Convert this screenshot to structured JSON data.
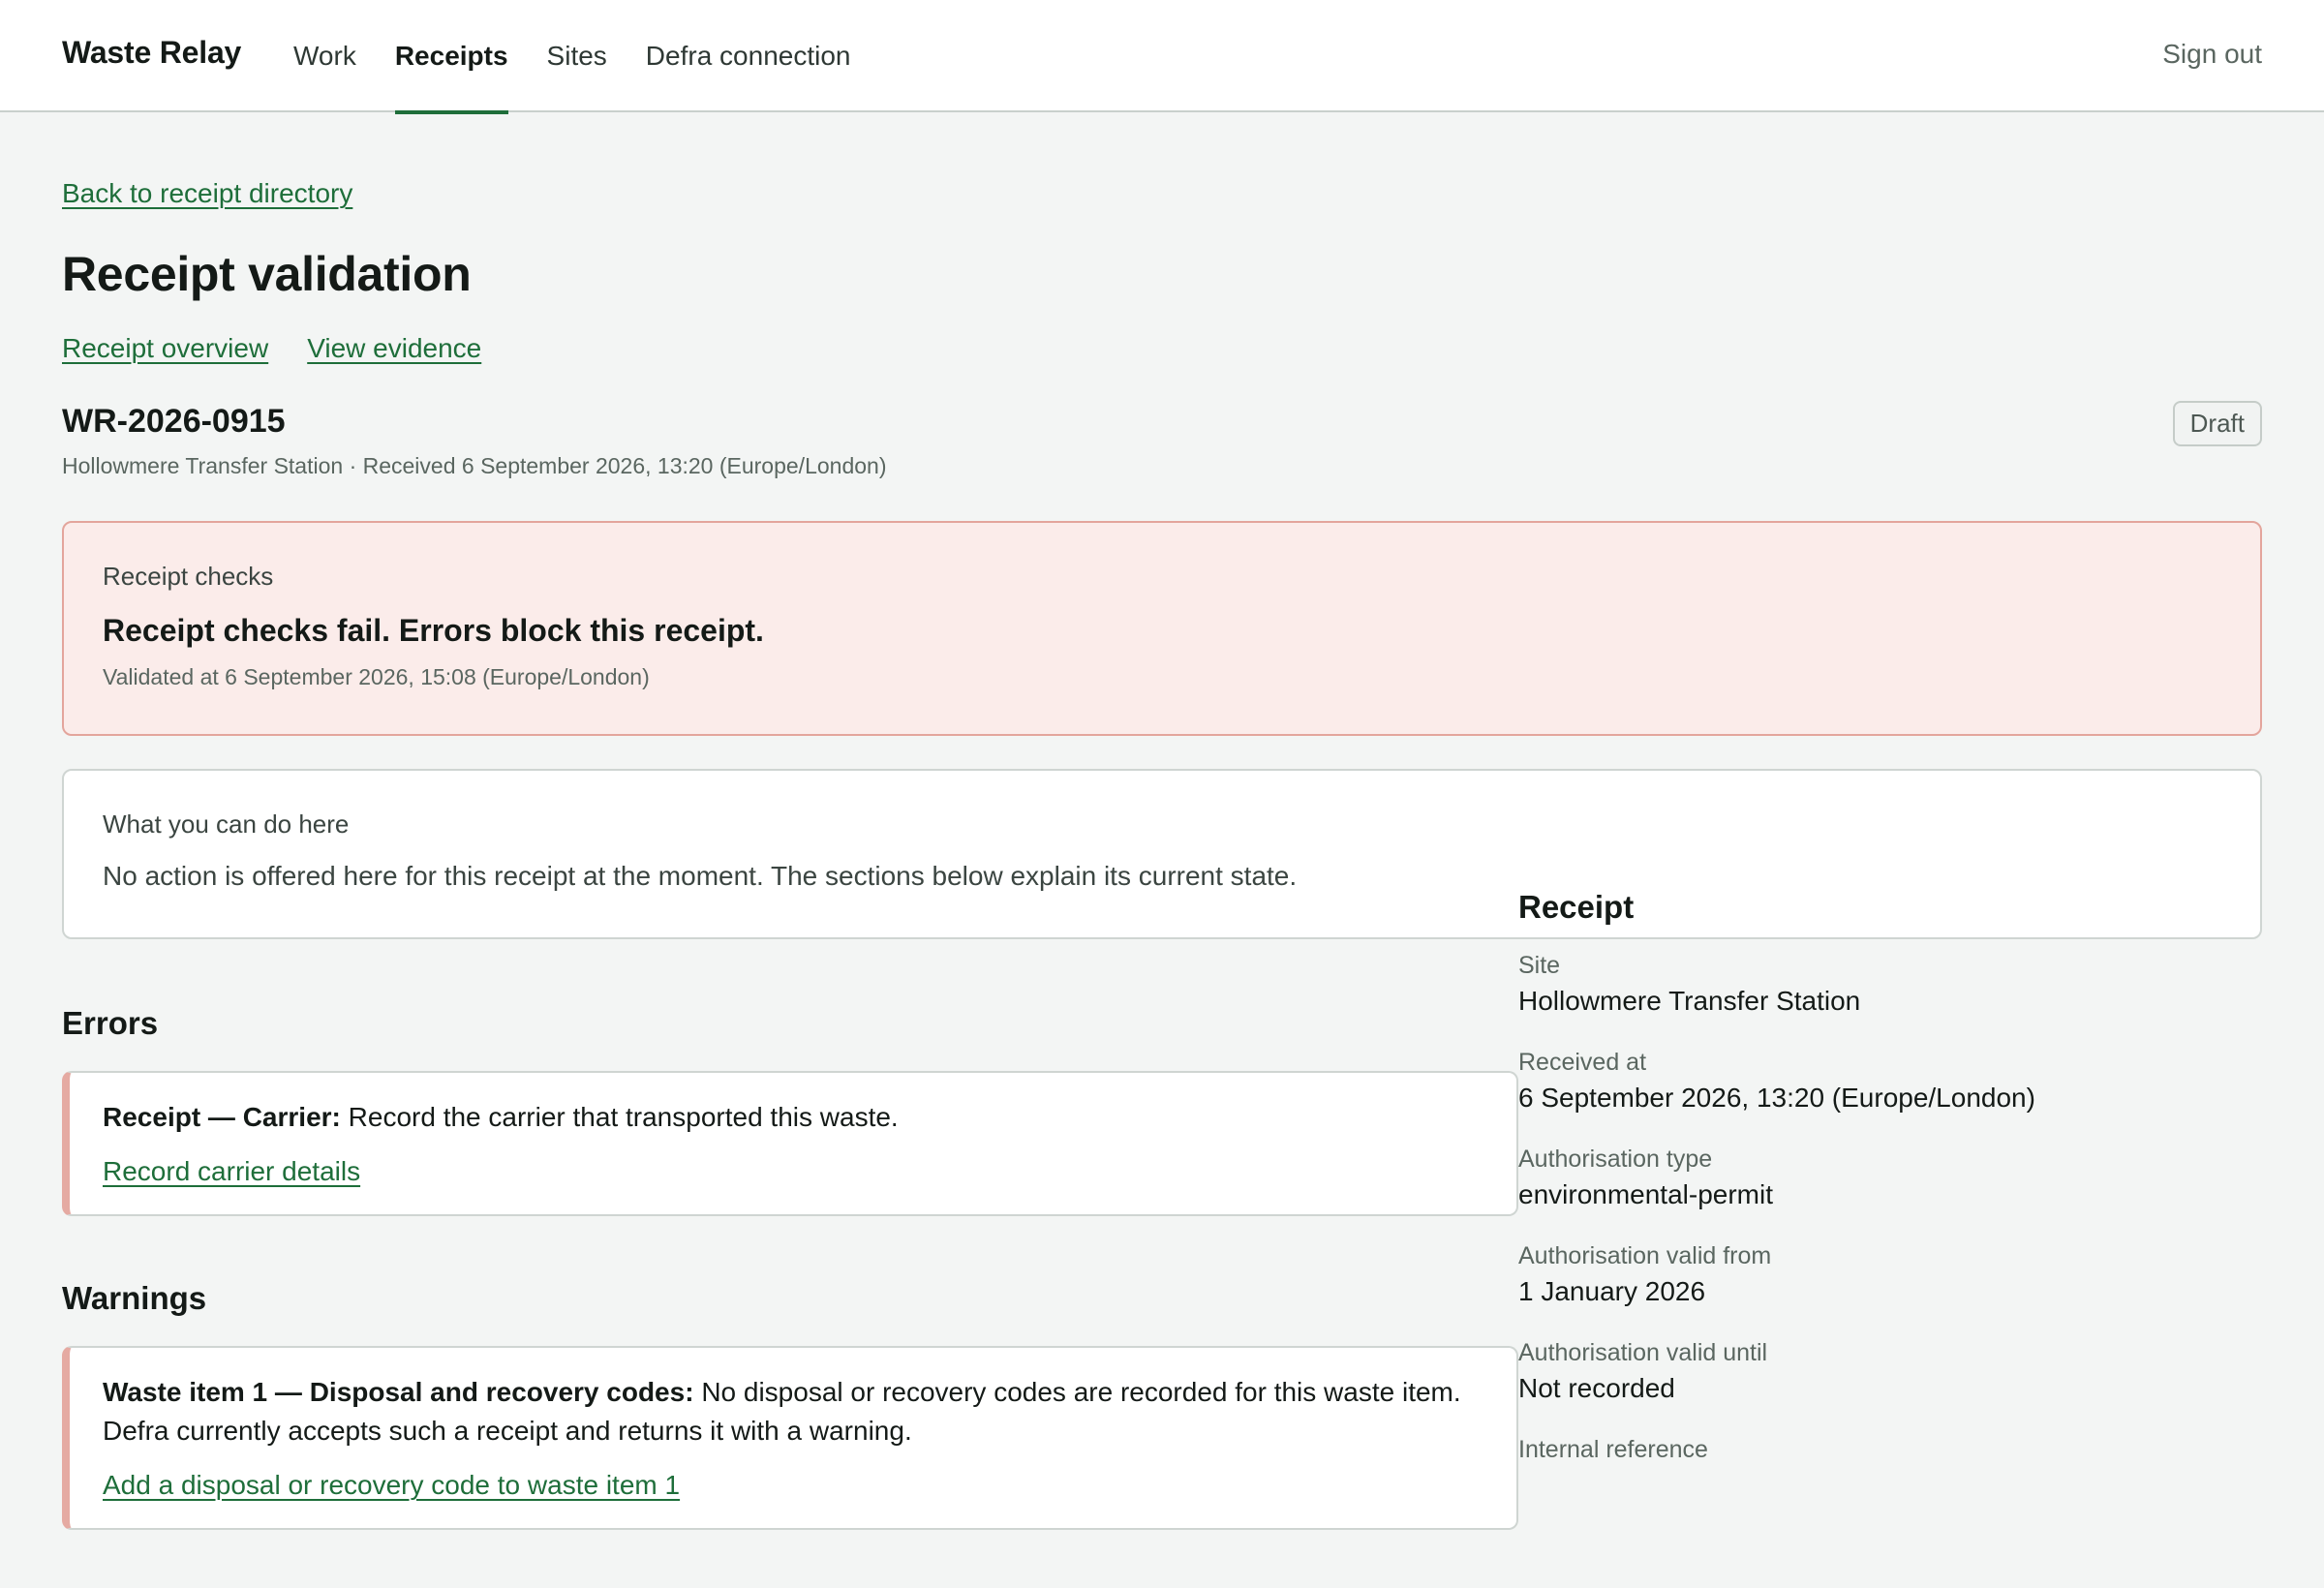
{
  "header": {
    "brand": "Waste Relay",
    "nav": [
      {
        "label": "Work",
        "active": false
      },
      {
        "label": "Receipts",
        "active": true
      },
      {
        "label": "Sites",
        "active": false
      },
      {
        "label": "Defra connection",
        "active": false
      }
    ],
    "sign_out": "Sign out"
  },
  "page": {
    "back_link": "Back to receipt directory",
    "title": "Receipt validation",
    "sub_links": [
      "Receipt overview",
      "View evidence"
    ],
    "receipt_ref": "WR-2026-0915",
    "receipt_meta": "Hollowmere Transfer Station · Received 6 September 2026, 13:20 (Europe/London)",
    "status": "Draft"
  },
  "checks": {
    "kicker": "Receipt checks",
    "headline": "Receipt checks fail. Errors block this receipt.",
    "validated_at": "Validated at 6 September 2026, 15:08 (Europe/London)"
  },
  "actions": {
    "kicker": "What you can do here",
    "body": "No action is offered here for this receipt at the moment. The sections below explain its current state."
  },
  "errors": {
    "heading": "Errors",
    "items": [
      {
        "subject": "Receipt — Carrier:",
        "message": "Record the carrier that transported this waste.",
        "link": "Record carrier details"
      }
    ]
  },
  "warnings": {
    "heading": "Warnings",
    "items": [
      {
        "subject": "Waste item 1 — Disposal and recovery codes:",
        "message": "No disposal or recovery codes are recorded for this waste item. Defra currently accepts such a receipt and returns it with a warning.",
        "link": "Add a disposal or recovery code to waste item 1"
      }
    ]
  },
  "sidebar": {
    "title": "Receipt",
    "rows": [
      {
        "label": "Site",
        "value": "Hollowmere Transfer Station"
      },
      {
        "label": "Received at",
        "value": "6 September 2026, 13:20 (Europe/London)"
      },
      {
        "label": "Authorisation type",
        "value": "environmental-permit"
      },
      {
        "label": "Authorisation valid from",
        "value": "1 January 2026"
      },
      {
        "label": "Authorisation valid until",
        "value": "Not recorded"
      },
      {
        "label": "Internal reference",
        "value": ""
      }
    ]
  }
}
